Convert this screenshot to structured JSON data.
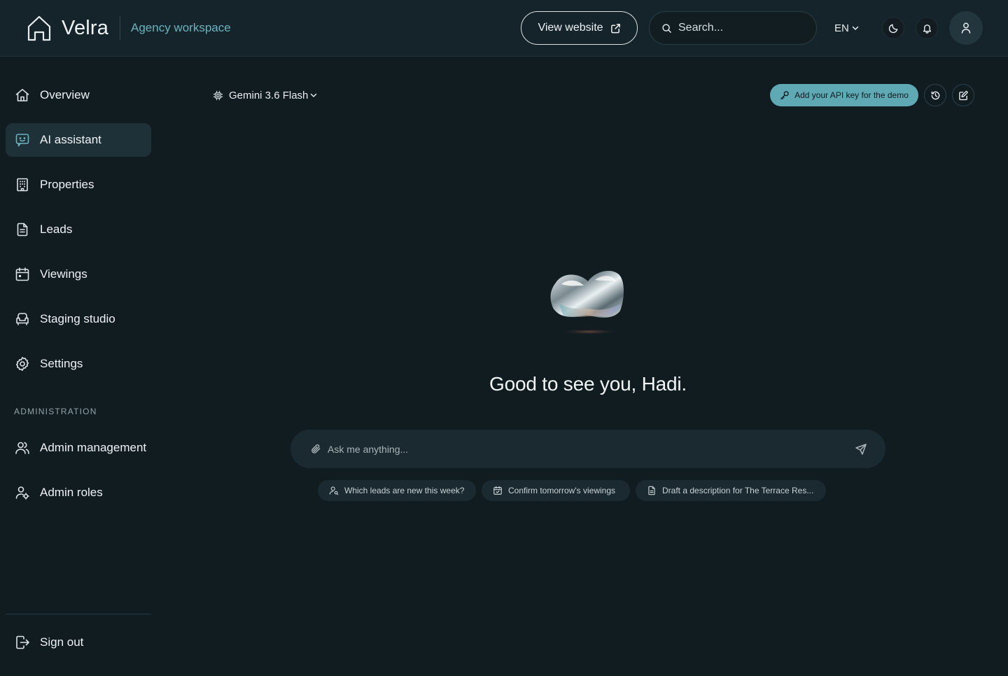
{
  "header": {
    "brand": "Velra",
    "workspace": "Agency workspace",
    "view_website": "View website",
    "search_placeholder": "Search...",
    "language": "EN"
  },
  "sidebar": {
    "items": [
      {
        "label": "Overview",
        "icon": "home-icon"
      },
      {
        "label": "AI assistant",
        "icon": "chat-bot-icon",
        "active": true
      },
      {
        "label": "Properties",
        "icon": "building-icon"
      },
      {
        "label": "Leads",
        "icon": "document-icon"
      },
      {
        "label": "Viewings",
        "icon": "calendar-icon"
      },
      {
        "label": "Staging studio",
        "icon": "armchair-icon"
      },
      {
        "label": "Settings",
        "icon": "gear-icon"
      }
    ],
    "section_label": "ADMINISTRATION",
    "admin_items": [
      {
        "label": "Admin management",
        "icon": "users-icon"
      },
      {
        "label": "Admin roles",
        "icon": "user-roles-icon"
      }
    ],
    "sign_out": "Sign out"
  },
  "main": {
    "model": "Gemini 3.6 Flash",
    "api_key_cta": "Add your API key for the demo",
    "greeting": "Good to see you, Hadi.",
    "chat_placeholder": "Ask me anything...",
    "suggestions": [
      "Which leads are new this week?",
      "Confirm tomorrow's viewings",
      "Draft a description for The Terrace Res..."
    ]
  },
  "colors": {
    "background": "#111c21",
    "header": "#15232a",
    "accent": "#5fa9b5",
    "active_nav": "#1f3138"
  }
}
